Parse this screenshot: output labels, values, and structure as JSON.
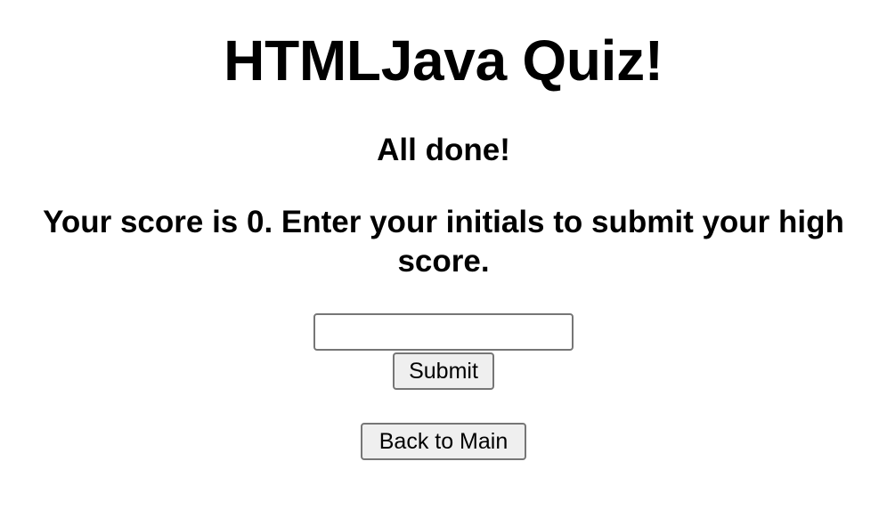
{
  "quiz": {
    "title": "HTMLJava Quiz!",
    "done_heading": "All done!",
    "score_message": "Your score is 0. Enter your initials to submit your high score."
  },
  "form": {
    "initials_value": "",
    "initials_placeholder": "",
    "submit_label": "Submit"
  },
  "navigation": {
    "back_label": "Back to Main"
  }
}
